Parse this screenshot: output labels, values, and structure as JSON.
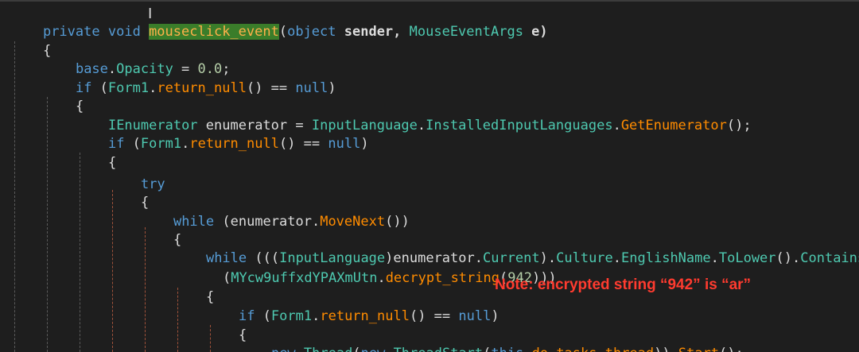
{
  "colors": {
    "background": "#1e1e1e",
    "keyword": "#569cd6",
    "type": "#4ec9b0",
    "method": "#ff8c00",
    "number": "#b5cea8",
    "highlight": "#3a7d2a",
    "note": "#ff3b2f"
  },
  "code": {
    "l1": {
      "private": "private",
      "void": "void",
      "name_a": "mouse",
      "name_b": "click_event",
      "paren": "(",
      "object": "object",
      "sender": " sender, ",
      "args_type": "MouseEventArgs",
      "e": " e)"
    },
    "l2": "{",
    "l3": {
      "base": "base",
      "dot": ".",
      "prop": "Opacity",
      "eq": " = ",
      "num": "0.0",
      "semi": ";"
    },
    "l4": {
      "if": "if",
      "open": " (",
      "form": "Form1",
      "dot": ".",
      "method": "return_null",
      "rest": "() == ",
      "null": "null",
      "close": ")"
    },
    "l5": "{",
    "l6": {
      "type": "IEnumerator",
      "var": " enumerator = ",
      "cls": "InputLanguage",
      "dot1": ".",
      "prop": "InstalledInputLanguages",
      "dot2": ".",
      "method": "GetEnumerator",
      "end": "();"
    },
    "l7": {
      "if": "if",
      "open": " (",
      "form": "Form1",
      "dot": ".",
      "method": "return_null",
      "rest": "() == ",
      "null": "null",
      "close": ")"
    },
    "l8": "{",
    "l9": "try",
    "l10": "{",
    "l11": {
      "while": "while",
      "open": " (enumerator.",
      "method": "MoveNext",
      "close": "())"
    },
    "l12": "{",
    "l13": {
      "while": "while",
      "open": " (((",
      "type": "InputLanguage",
      "mid": ")enumerator.",
      "current": "Current",
      "dot1": ").",
      "culture": "Culture",
      "dot2": ".",
      "english": "EnglishName",
      "dot3": ".",
      "lower": "ToLower",
      "dot4": "().",
      "contains": "Contains"
    },
    "l14": {
      "open": "(",
      "cls": "MYcw9uffxdYPAXmUtn",
      "dot": ".",
      "method": "decrypt_string",
      "p1": "(",
      "num": "942",
      "close": ")))"
    },
    "l15": "{",
    "l16": {
      "if": "if",
      "open": " (",
      "form": "Form1",
      "dot": ".",
      "method": "return_null",
      "rest": "() == ",
      "null": "null",
      "close": ")"
    },
    "l17": "{",
    "l18": {
      "new1": "new",
      "sp": " ",
      "thread": "Thread",
      "p1": "(",
      "new2": "new",
      "sp2": " ",
      "ts": "ThreadStart",
      "p2": "(",
      "this": "this",
      "dot": ".",
      "method": "do_tasks_thread",
      "p3": ")).",
      "start": "Start",
      "end": "();"
    }
  },
  "annotation": {
    "note": "Note: encrypted string “942” is “ar”"
  }
}
